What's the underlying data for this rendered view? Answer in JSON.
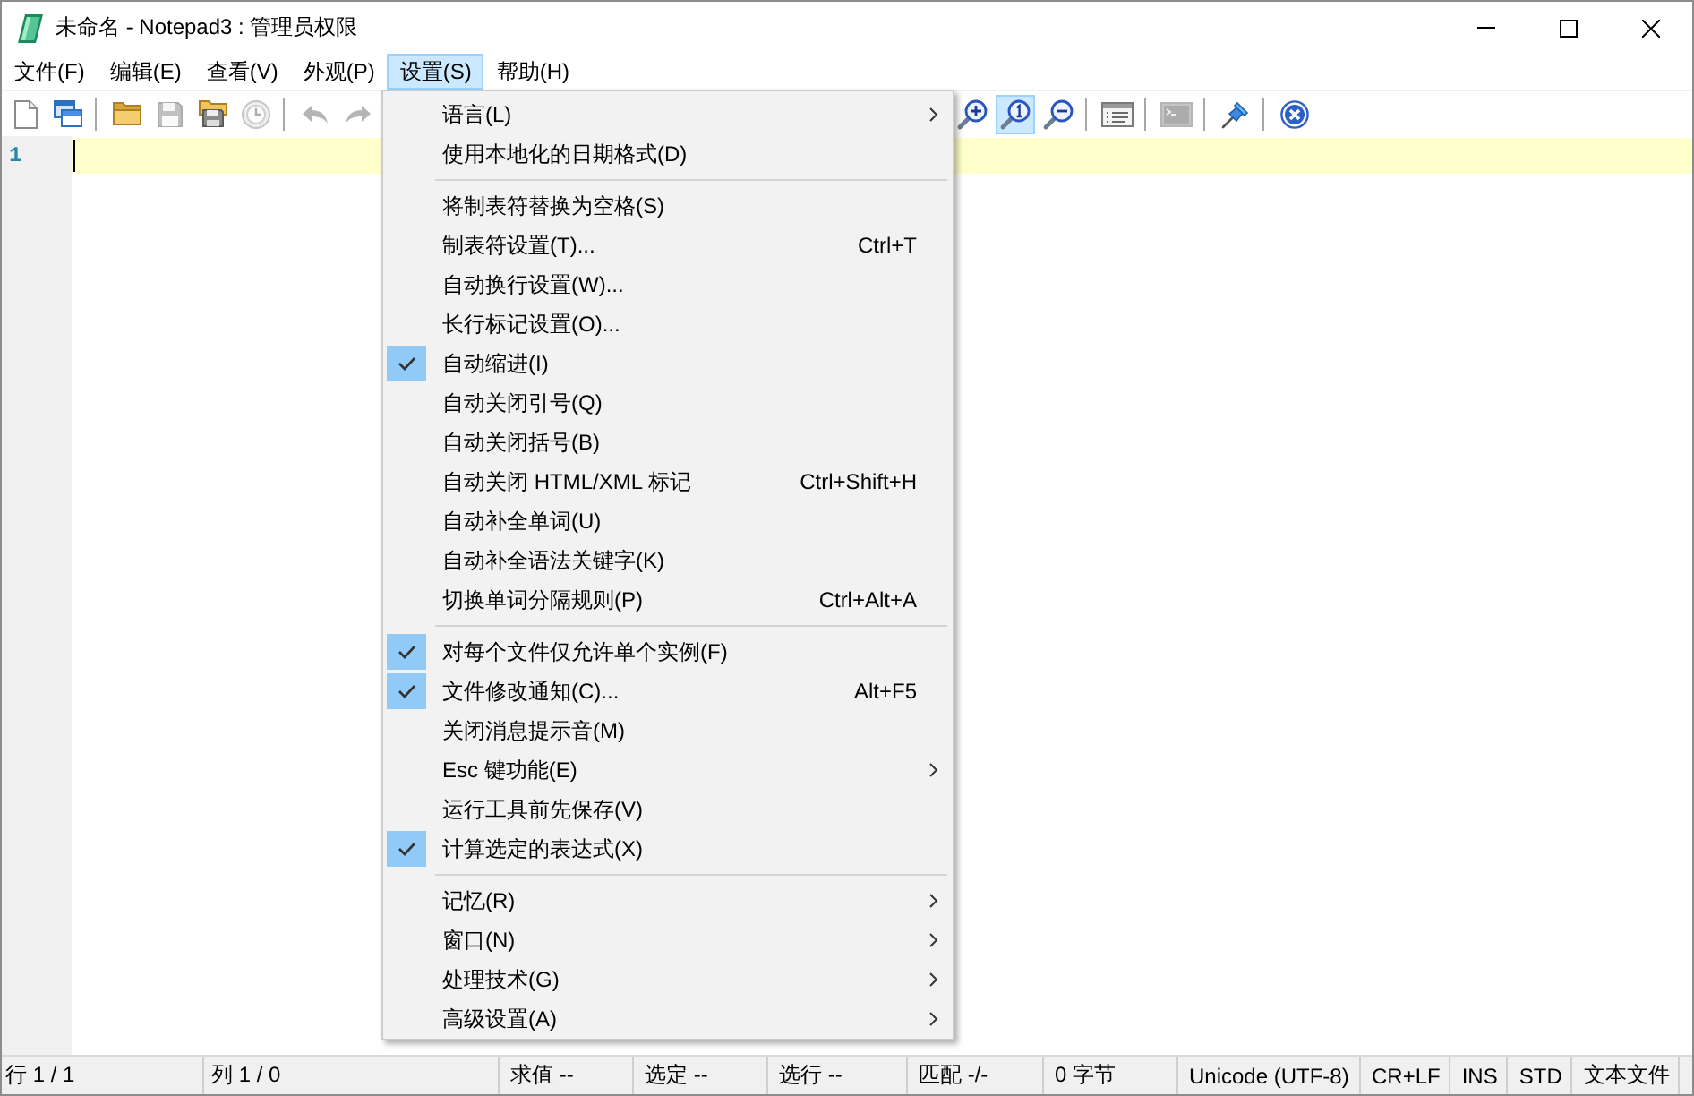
{
  "window": {
    "title": "未命名 - Notepad3 : 管理员权限"
  },
  "menu_bar": [
    {
      "label": "文件(F)",
      "selected": false
    },
    {
      "label": "编辑(E)",
      "selected": false
    },
    {
      "label": "查看(V)",
      "selected": false
    },
    {
      "label": "外观(P)",
      "selected": false
    },
    {
      "label": "设置(S)",
      "selected": true
    },
    {
      "label": "帮助(H)",
      "selected": false
    }
  ],
  "toolbar": {
    "left": [
      {
        "kind": "button",
        "pressed": false,
        "disabled": false
      },
      {
        "kind": "button",
        "pressed": false,
        "disabled": false
      },
      {
        "kind": "separator"
      },
      {
        "kind": "button",
        "pressed": false,
        "disabled": false
      },
      {
        "kind": "button",
        "pressed": false,
        "disabled": true
      },
      {
        "kind": "button",
        "pressed": false,
        "disabled": false
      },
      {
        "kind": "button",
        "pressed": false,
        "disabled": true
      },
      {
        "kind": "separator"
      },
      {
        "kind": "button",
        "pressed": false,
        "disabled": true
      },
      {
        "kind": "button",
        "pressed": false,
        "disabled": true
      }
    ],
    "right": [
      {
        "kind": "button",
        "pressed": false,
        "disabled": false
      },
      {
        "kind": "button",
        "pressed": true,
        "disabled": false
      },
      {
        "kind": "button",
        "pressed": false,
        "disabled": false
      },
      {
        "kind": "separator"
      },
      {
        "kind": "button",
        "pressed": false,
        "disabled": false
      },
      {
        "kind": "separator"
      },
      {
        "kind": "button",
        "pressed": false,
        "disabled": true
      },
      {
        "kind": "separator"
      },
      {
        "kind": "button",
        "pressed": false,
        "disabled": false
      },
      {
        "kind": "separator"
      },
      {
        "kind": "button",
        "pressed": false,
        "disabled": false
      }
    ]
  },
  "editor": {
    "lines": [
      {
        "number": "1",
        "current": true
      }
    ]
  },
  "settings_menu": {
    "sections": [
      {
        "items": [
          {
            "label": "语言(L)",
            "checked": false,
            "submenu": true
          },
          {
            "label": "使用本地化的日期格式(D)",
            "checked": false,
            "submenu": false
          }
        ]
      },
      {
        "items": [
          {
            "label": "将制表符替换为空格(S)",
            "checked": false,
            "submenu": false
          },
          {
            "label": "制表符设置(T)...",
            "shortcut": "Ctrl+T",
            "checked": false,
            "submenu": false
          },
          {
            "label": "自动换行设置(W)...",
            "checked": false,
            "submenu": false
          },
          {
            "label": "长行标记设置(O)...",
            "checked": false,
            "submenu": false
          },
          {
            "label": "自动缩进(I)",
            "checked": true,
            "submenu": false
          },
          {
            "label": "自动关闭引号(Q)",
            "checked": false,
            "submenu": false
          },
          {
            "label": "自动关闭括号(B)",
            "checked": false,
            "submenu": false
          },
          {
            "label": "自动关闭 HTML/XML 标记",
            "shortcut": "Ctrl+Shift+H",
            "checked": false,
            "submenu": false
          },
          {
            "label": "自动补全单词(U)",
            "checked": false,
            "submenu": false
          },
          {
            "label": "自动补全语法关键字(K)",
            "checked": false,
            "submenu": false
          },
          {
            "label": "切换单词分隔规则(P)",
            "shortcut": "Ctrl+Alt+A",
            "checked": false,
            "submenu": false
          }
        ]
      },
      {
        "items": [
          {
            "label": "对每个文件仅允许单个实例(F)",
            "checked": true,
            "submenu": false
          },
          {
            "label": "文件修改通知(C)...",
            "shortcut": "Alt+F5",
            "checked": true,
            "submenu": false
          },
          {
            "label": "关闭消息提示音(M)",
            "checked": false,
            "submenu": false
          },
          {
            "label": "Esc 键功能(E)",
            "checked": false,
            "submenu": true
          },
          {
            "label": "运行工具前先保存(V)",
            "checked": false,
            "submenu": false
          },
          {
            "label": "计算选定的表达式(X)",
            "checked": true,
            "submenu": false
          }
        ]
      },
      {
        "items": [
          {
            "label": "记忆(R)",
            "checked": false,
            "submenu": true
          },
          {
            "label": "窗口(N)",
            "checked": false,
            "submenu": true
          },
          {
            "label": "处理技术(G)",
            "checked": false,
            "submenu": true
          },
          {
            "label": "高级设置(A)",
            "checked": false,
            "submenu": true
          }
        ]
      }
    ]
  },
  "status_bar": {
    "fields": [
      "行 1 / 1",
      "列 1 / 0",
      "求值 --",
      "选定 --",
      "选行 --",
      "匹配 -/-",
      "0 字节",
      "Unicode (UTF-8)",
      "CR+LF",
      "INS",
      "STD",
      "文本文件"
    ]
  }
}
